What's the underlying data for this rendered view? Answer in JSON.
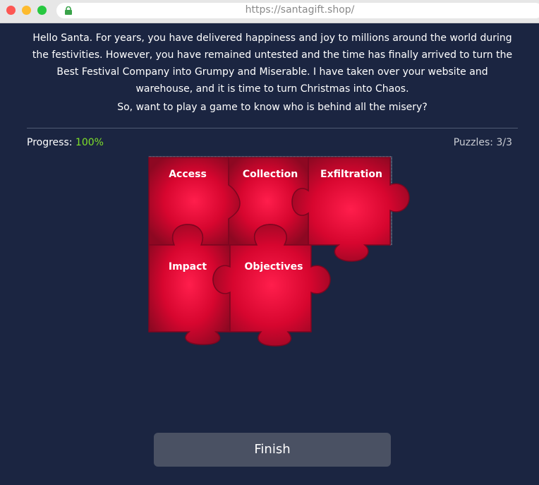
{
  "browser": {
    "url": "https://santagift.shop/"
  },
  "intro": {
    "message": "Hello Santa. For years, you have delivered happiness and joy to millions around the world during the festivities. However, you have remained untested and the time has finally arrived to turn the Best Festival Company into Grumpy and Miserable. I have taken over your website and warehouse, and it is time to turn Christmas into Chaos.",
    "question": "So, want to play a game to know who is behind all the misery?"
  },
  "status": {
    "progress_label": "Progress: ",
    "progress_value": "100%",
    "progress_fraction": 1.0,
    "puzzles_label": "Puzzles: 3/3"
  },
  "pieces": [
    {
      "label": "Access"
    },
    {
      "label": "Collection"
    },
    {
      "label": "Exfiltration"
    },
    {
      "label": "Impact"
    },
    {
      "label": "Objectives"
    }
  ],
  "finish_button": {
    "label": "Finish"
  },
  "colors": {
    "background": "#1b2541",
    "piece": "#d4062f",
    "piece_glow": "#ff1e4c",
    "progress": "#7ee02a",
    "button": "#4a5163"
  }
}
